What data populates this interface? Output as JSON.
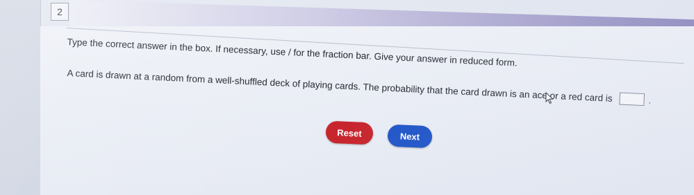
{
  "question": {
    "number": "2",
    "instruction": "Type the correct answer in the box. If necessary, use / for the fraction bar. Give your answer in reduced form.",
    "prompt": "A card is drawn at a random from a well-shuffled deck of playing cards. The probability that the card drawn is an ace or a red card is",
    "answer_value": "",
    "trailing": "."
  },
  "buttons": {
    "reset_label": "Reset",
    "next_label": "Next"
  },
  "colors": {
    "reset": "#c8232b",
    "next": "#1f55c8"
  },
  "icons": {
    "cursor": "mouse-pointer-icon"
  }
}
